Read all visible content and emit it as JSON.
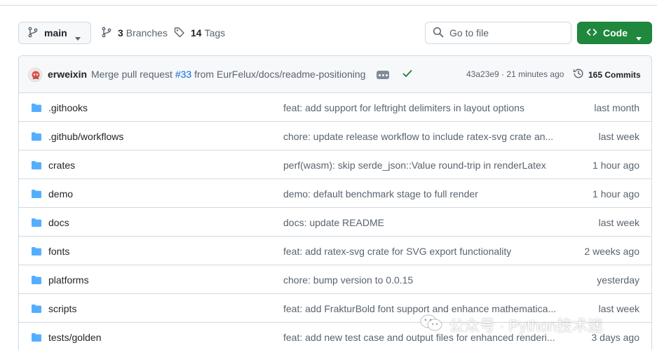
{
  "toolbar": {
    "branch": "main",
    "branches_count": "3",
    "branches_label": "Branches",
    "tags_count": "14",
    "tags_label": "Tags",
    "search_placeholder": "Go to file",
    "code_label": "Code"
  },
  "latest_commit": {
    "author": "erweixin",
    "message_prefix": "Merge pull request",
    "pr": "#33",
    "message_rest": "from EurFelux/docs/readme-positioning",
    "sha": "43a23e9",
    "separator": " · ",
    "time": "21 minutes ago",
    "commits_count": "165 Commits",
    "status_color": "#1a7f37"
  },
  "files": [
    {
      "name": ".githooks",
      "message": "feat: add support for leftright delimiters in layout options",
      "age": "last month",
      "icon": "folder-icon"
    },
    {
      "name": ".github/workflows",
      "message": "chore: update release workflow to include ratex-svg crate an...",
      "age": "last week",
      "icon": "folder-icon"
    },
    {
      "name": "crates",
      "message": "perf(wasm): skip serde_json::Value round-trip in renderLatex",
      "age": "1 hour ago",
      "icon": "folder-icon"
    },
    {
      "name": "demo",
      "message": "demo: default benchmark stage to full render",
      "age": "1 hour ago",
      "icon": "folder-icon"
    },
    {
      "name": "docs",
      "message": "docs: update README",
      "age": "last week",
      "icon": "folder-icon"
    },
    {
      "name": "fonts",
      "message": "feat: add ratex-svg crate for SVG export functionality",
      "age": "2 weeks ago",
      "icon": "folder-icon"
    },
    {
      "name": "platforms",
      "message": "chore: bump version to 0.0.15",
      "age": "yesterday",
      "icon": "folder-icon"
    },
    {
      "name": "scripts",
      "message": "feat: add FrakturBold font support and enhance mathematica...",
      "age": "last week",
      "icon": "folder-icon"
    },
    {
      "name": "tests/golden",
      "message": "feat: add new test case and output files for enhanced renderi...",
      "age": "3 days ago",
      "icon": "folder-icon"
    }
  ],
  "watermark": "公众号 · Python技术迷",
  "colors": {
    "accent": "#0969da",
    "folder": "#54aeff",
    "code_button": "#1f883d",
    "muted": "#59636e",
    "border": "#d1d9e0"
  }
}
